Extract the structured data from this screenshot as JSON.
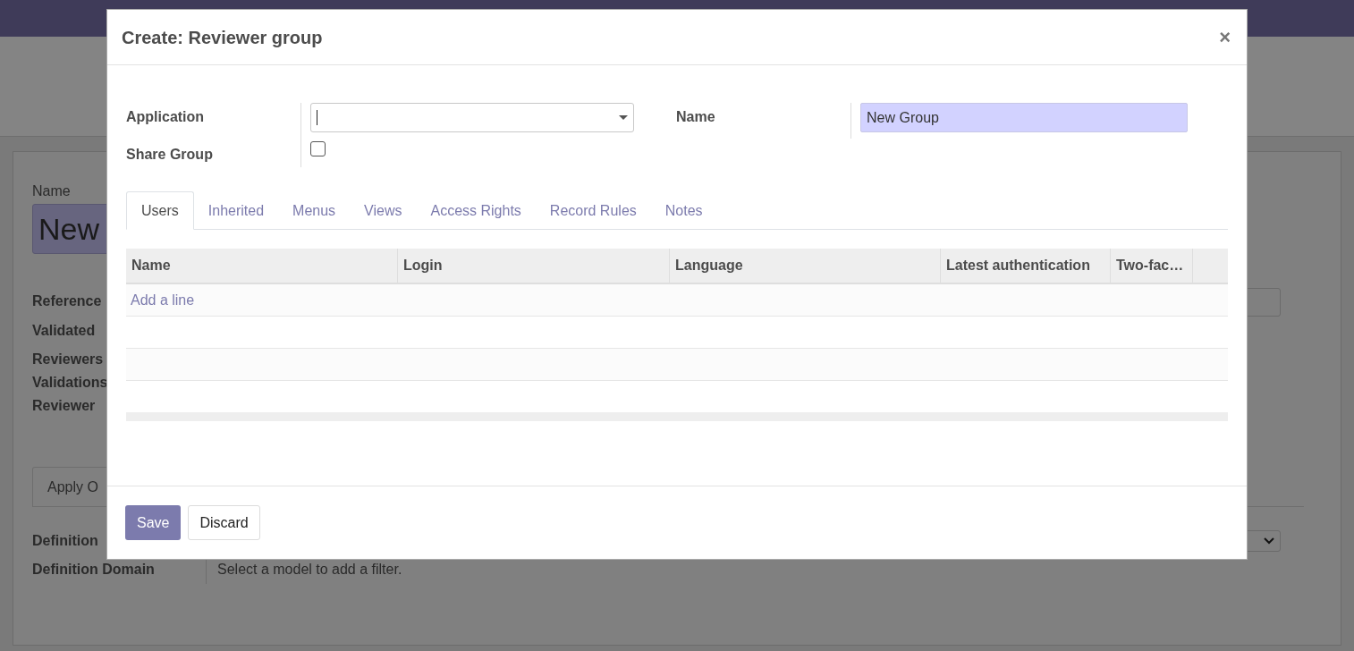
{
  "background_form": {
    "name_label": "Name",
    "name_value": "New",
    "fields": [
      {
        "label": "Reference"
      },
      {
        "label": "Validated"
      },
      {
        "label": "Reviewers"
      },
      {
        "label": "Validations"
      },
      {
        "label": "Reviewer"
      }
    ],
    "tabs": [
      {
        "label": "Apply O",
        "selected": true
      }
    ],
    "definition_fields": [
      {
        "label": "Definition",
        "kind": "select"
      },
      {
        "label": "Definition Domain",
        "kind": "text",
        "value": "Select a model to add a filter."
      }
    ]
  },
  "dialog": {
    "title": "Create: Reviewer group",
    "close": "×",
    "application": {
      "label": "Application"
    },
    "share_group": {
      "label": "Share Group",
      "checked": false
    },
    "name": {
      "label": "Name",
      "value": "New Group"
    },
    "tabs": [
      {
        "label": "Users",
        "selected": true
      },
      {
        "label": "Inherited",
        "selected": false
      },
      {
        "label": "Menus",
        "selected": false
      },
      {
        "label": "Views",
        "selected": false
      },
      {
        "label": "Access Rights",
        "selected": false
      },
      {
        "label": "Record Rules",
        "selected": false
      },
      {
        "label": "Notes",
        "selected": false
      }
    ],
    "table": {
      "columns": [
        "Name",
        "Login",
        "Language",
        "Latest authentication",
        "Two-fac…"
      ],
      "add_line": "Add a line"
    },
    "buttons": [
      {
        "label": "Save",
        "kind": "primary"
      },
      {
        "label": "Discard",
        "kind": "secondary"
      }
    ]
  }
}
